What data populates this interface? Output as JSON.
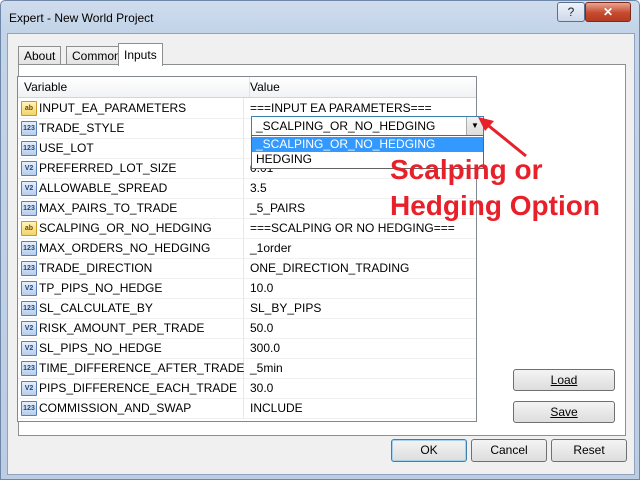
{
  "window": {
    "title": "Expert - New World Project",
    "help_label": "?",
    "close_label": "✕"
  },
  "tabs": [
    {
      "label": "About"
    },
    {
      "label": "Common"
    },
    {
      "label": "Inputs"
    }
  ],
  "grid": {
    "col_variable": "Variable",
    "col_value": "Value",
    "rows": [
      {
        "icon": "ab",
        "type": "string",
        "name": "INPUT_EA_PARAMETERS",
        "value": "===INPUT EA PARAMETERS==="
      },
      {
        "icon": "123",
        "type": "integer",
        "name": "TRADE_STYLE",
        "value": ""
      },
      {
        "icon": "123",
        "type": "integer",
        "name": "USE_LOT",
        "value": ""
      },
      {
        "icon": "V2",
        "type": "double",
        "name": "PREFERRED_LOT_SIZE",
        "value": "0.01"
      },
      {
        "icon": "V2",
        "type": "double",
        "name": "ALLOWABLE_SPREAD",
        "value": "3.5"
      },
      {
        "icon": "123",
        "type": "integer",
        "name": "MAX_PAIRS_TO_TRADE",
        "value": "_5_PAIRS"
      },
      {
        "icon": "ab",
        "type": "string",
        "name": "SCALPING_OR_NO_HEDGING",
        "value": "===SCALPING OR NO HEDGING==="
      },
      {
        "icon": "123",
        "type": "integer",
        "name": "MAX_ORDERS_NO_HEDGING",
        "value": "_1order"
      },
      {
        "icon": "123",
        "type": "integer",
        "name": "TRADE_DIRECTION",
        "value": "ONE_DIRECTION_TRADING"
      },
      {
        "icon": "V2",
        "type": "double",
        "name": "TP_PIPS_NO_HEDGE",
        "value": "10.0"
      },
      {
        "icon": "123",
        "type": "integer",
        "name": "SL_CALCULATE_BY",
        "value": "SL_BY_PIPS"
      },
      {
        "icon": "V2",
        "type": "double",
        "name": "RISK_AMOUNT_PER_TRADE",
        "value": "50.0"
      },
      {
        "icon": "V2",
        "type": "double",
        "name": "SL_PIPS_NO_HEDGE",
        "value": "300.0"
      },
      {
        "icon": "123",
        "type": "integer",
        "name": "TIME_DIFFERENCE_AFTER_TRADE",
        "value": "_5min"
      },
      {
        "icon": "V2",
        "type": "double",
        "name": "PIPS_DIFFERENCE_EACH_TRADE",
        "value": "30.0"
      },
      {
        "icon": "123",
        "type": "integer",
        "name": "COMMISSION_AND_SWAP",
        "value": "INCLUDE"
      }
    ]
  },
  "combo": {
    "selected": "_SCALPING_OR_NO_HEDGING",
    "options": [
      "_SCALPING_OR_NO_HEDGING",
      "HEDGING"
    ]
  },
  "annotation": {
    "line1": "Scalping or",
    "line2": "Hedging Option",
    "color": "#e8202a"
  },
  "side_buttons": {
    "load": "Load",
    "save": "Save"
  },
  "footer_buttons": {
    "ok": "OK",
    "cancel": "Cancel",
    "reset": "Reset"
  }
}
